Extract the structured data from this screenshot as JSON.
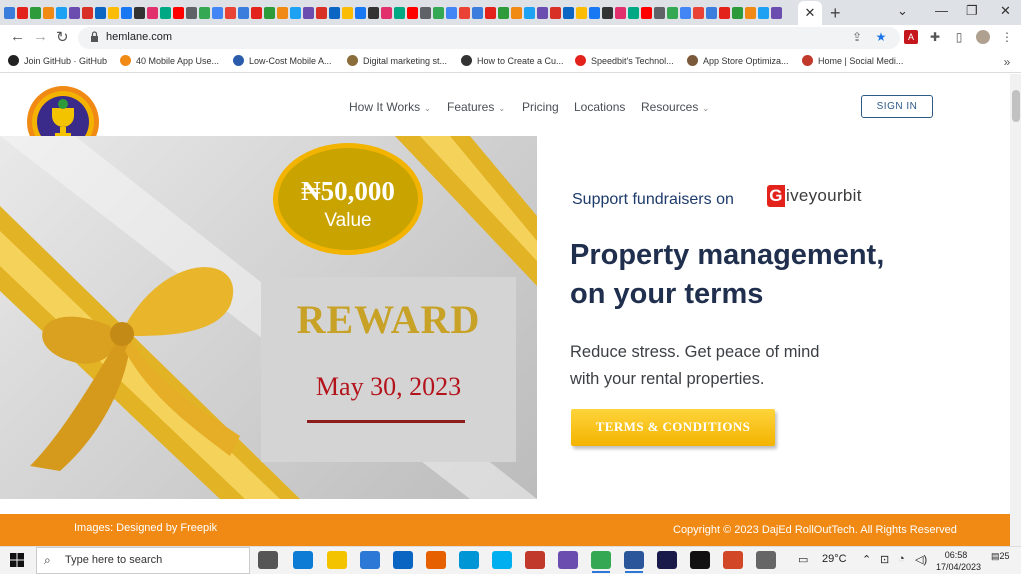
{
  "browser": {
    "active_tab_close": "✕",
    "new_tab": "+",
    "window_controls": {
      "dropdown": "⌄",
      "minimize": "—",
      "restore": "❐",
      "close": "✕"
    },
    "url": "hemlane.com",
    "bookmarks": [
      {
        "label": "Join GitHub · GitHub",
        "icon": "github-icon",
        "color": "#222222"
      },
      {
        "label": "40 Mobile App Use...",
        "icon": "app-icon",
        "color": "#f08a14"
      },
      {
        "label": "Low-Cost Mobile A...",
        "icon": "e-icon",
        "color": "#2b5cab"
      },
      {
        "label": "Digital marketing st...",
        "icon": "marketing-icon",
        "color": "#8a6d3b"
      },
      {
        "label": "How to Create a Cu...",
        "icon": "bars-icon",
        "color": "#333333"
      },
      {
        "label": "Speedbit's Technol...",
        "icon": "bolt-icon",
        "color": "#e3221b"
      },
      {
        "label": "App Store Optimiza...",
        "icon": "avatar-icon",
        "color": "#7b5a3c"
      },
      {
        "label": "Home | Social Medi...",
        "icon": "social-icon",
        "color": "#c0392b"
      }
    ]
  },
  "site": {
    "nav": [
      {
        "label": "How It Works",
        "caret": "⌄"
      },
      {
        "label": "Features",
        "caret": "⌄"
      },
      {
        "label": "Pricing",
        "caret": ""
      },
      {
        "label": "Locations",
        "caret": ""
      },
      {
        "label": "Resources",
        "caret": "⌄"
      }
    ],
    "signin": "SIGN IN",
    "promo": {
      "amount": "₦50,000",
      "value_label": "Value",
      "reward": "REWARD",
      "date": "May 30, 2023"
    },
    "support_text": "Support fundraisers on",
    "giveyourbit_letter": "G",
    "giveyourbit_rest": "iveyourbit",
    "headline_line1": "Property management,",
    "headline_line2": "on your terms",
    "sub_line1": "Reduce stress. Get peace of mind",
    "sub_line2": "with your rental properties.",
    "terms_button": "TERMS & CONDITIONS",
    "footer_left": "Images: Designed by Freepik",
    "footer_right": "Copyright © 2023 DajEd RollOutTech. All Rights Reserved",
    "colors": {
      "accent": "#f08a14",
      "navy": "#1f2f4d",
      "gold": "#c7a227",
      "red": "#b3141c"
    }
  },
  "taskbar": {
    "search_placeholder": "Type here to search",
    "temperature": "29°C",
    "time": "06:58",
    "date": "17/04/2023",
    "notifications": "25"
  }
}
